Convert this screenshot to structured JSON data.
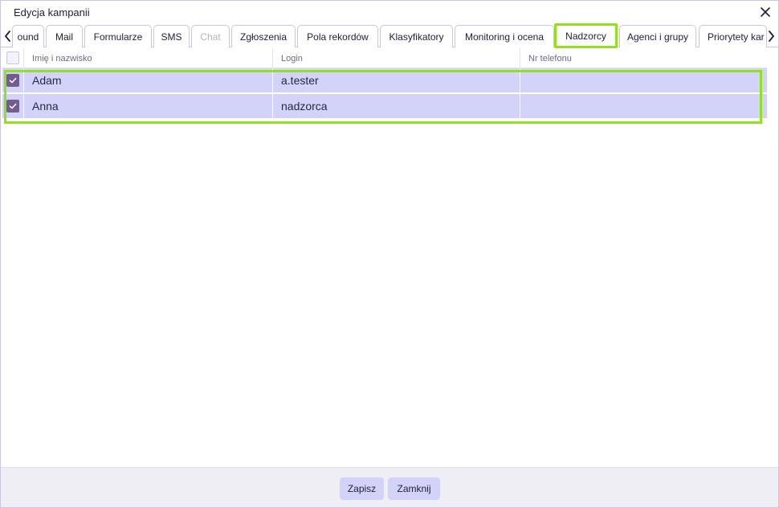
{
  "window": {
    "title": "Edycja kampanii"
  },
  "tabs": [
    {
      "label": "ound",
      "state": "normal"
    },
    {
      "label": "Mail",
      "state": "normal"
    },
    {
      "label": "Formularze",
      "state": "normal"
    },
    {
      "label": "SMS",
      "state": "normal"
    },
    {
      "label": "Chat",
      "state": "disabled"
    },
    {
      "label": "Zgłoszenia",
      "state": "normal"
    },
    {
      "label": "Pola rekordów",
      "state": "normal"
    },
    {
      "label": "Klasyfikatory",
      "state": "normal"
    },
    {
      "label": "Monitoring i ocena",
      "state": "normal"
    },
    {
      "label": "Nadzorcy",
      "state": "active"
    },
    {
      "label": "Agenci i grupy",
      "state": "normal"
    },
    {
      "label": "Priorytety kar",
      "state": "normal"
    }
  ],
  "table": {
    "columns": [
      "Imię i nazwisko",
      "Login",
      "Nr telefonu"
    ],
    "rows": [
      {
        "checked": true,
        "name": "Adam",
        "login": "a.tester",
        "phone": ""
      },
      {
        "checked": true,
        "name": "Anna",
        "login": "nadzorca",
        "phone": ""
      }
    ]
  },
  "footer": {
    "save_label": "Zapisz",
    "close_label": "Zamknij"
  },
  "colors": {
    "accent": "#d3d3fa",
    "highlight": "#8fe21d",
    "checkbox": "#6f5e8e"
  },
  "icons": {
    "close": "close-icon",
    "prev": "chevron-left-icon",
    "next": "chevron-right-icon",
    "check": "check-icon"
  }
}
